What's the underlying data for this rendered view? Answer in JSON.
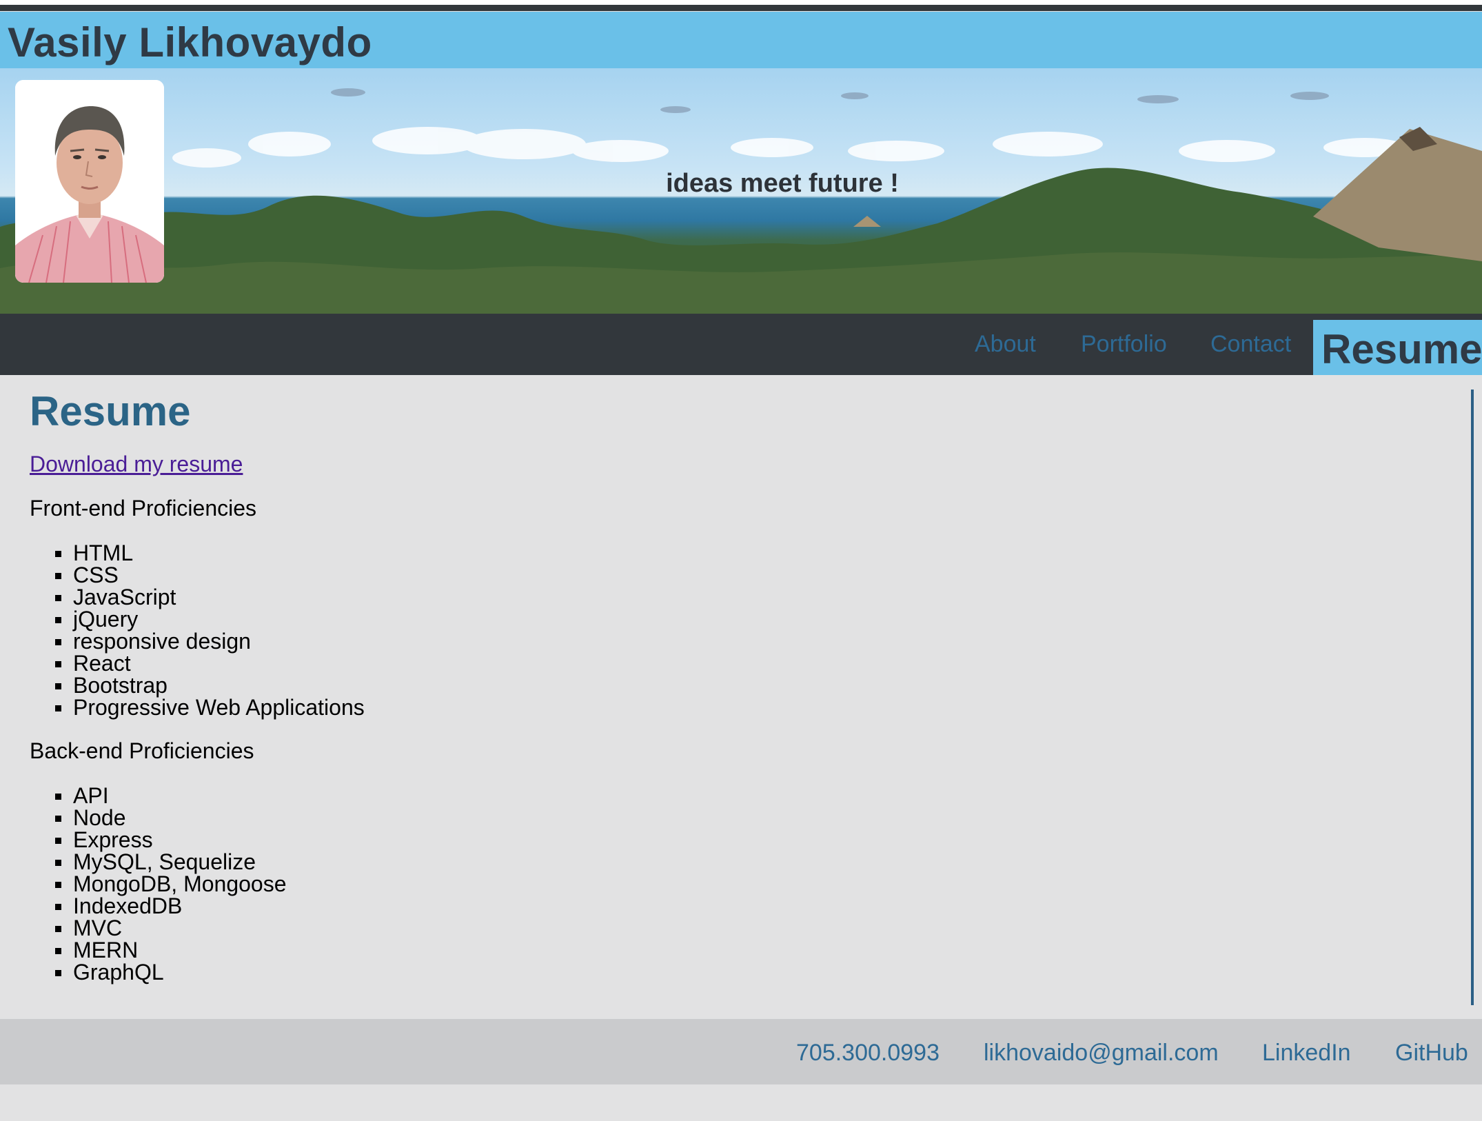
{
  "header": {
    "site_title": "Vasily Likhovaydo"
  },
  "hero": {
    "tagline": "ideas meet future !"
  },
  "nav": {
    "about": "About",
    "portfolio": "Portfolio",
    "contact": "Contact",
    "resume_active": "Resume"
  },
  "main": {
    "title": "Resume",
    "download_link": "Download my resume",
    "frontend": {
      "heading": "Front-end Proficiencies",
      "items": [
        "HTML",
        "CSS",
        "JavaScript",
        "jQuery",
        "responsive design",
        "React",
        "Bootstrap",
        "Progressive Web Applications"
      ]
    },
    "backend": {
      "heading": "Back-end Proficiencies",
      "items": [
        "API",
        "Node",
        "Express",
        "MySQL, Sequelize",
        "MongoDB, Mongoose",
        "IndexedDB",
        "MVC",
        "MERN",
        "GraphQL"
      ]
    }
  },
  "footer": {
    "phone": "705.300.0993",
    "email": "likhovaido@gmail.com",
    "linkedin": "LinkedIn",
    "github": "GitHub"
  },
  "colors": {
    "header_bg": "#6ac0e8",
    "nav_bg": "#32373c",
    "link_blue": "#2d6a95",
    "page_bg": "#e2e2e3",
    "footer_bg": "#cacbcd"
  }
}
